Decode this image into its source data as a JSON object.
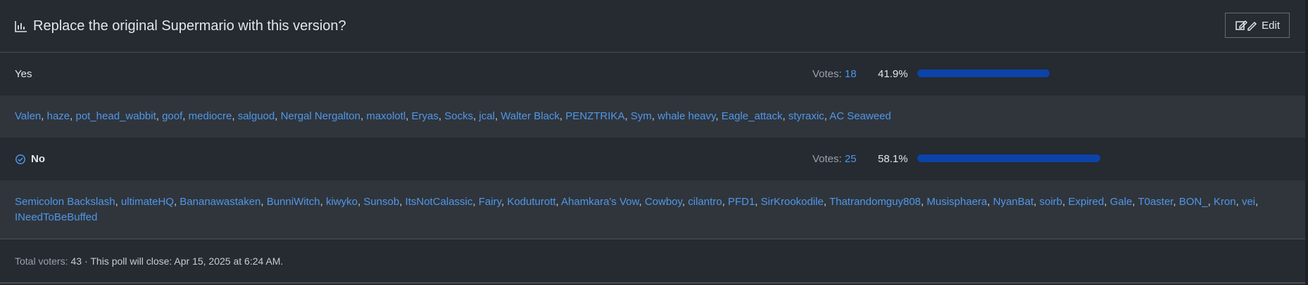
{
  "poll": {
    "title": "Replace the original Supermario with this version?",
    "edit_label": "Edit",
    "votes_label": "Votes: ",
    "total_voters_label": "Total voters:",
    "total_voters": "43",
    "closing_text": "· This poll will close: Apr 15, 2025 at 6:24 AM.",
    "options": [
      {
        "label": "Yes",
        "votes": "18",
        "percent": "41.9%",
        "fraction": 0.419,
        "selected": false,
        "voters": [
          "Valen",
          "haze",
          "pot_head_wabbit",
          "goof",
          "mediocre",
          "salguod",
          "Nergal Nergalton",
          "maxolotl",
          "Eryas",
          "Socks",
          "jcal",
          "Walter Black",
          "PENZTRIKA",
          "Sym",
          "whale heavy",
          "Eagle_attack",
          "styraxic",
          "AC Seaweed"
        ]
      },
      {
        "label": "No",
        "votes": "25",
        "percent": "58.1%",
        "fraction": 0.581,
        "selected": true,
        "voters": [
          "Semicolon Backslash",
          "ultimateHQ",
          "Bananawastaken",
          "BunniWitch",
          "kiwyko",
          "Sunsob",
          "ItsNotCalassic",
          "Fairy",
          "Koduturott",
          "Ahamkara's Vow",
          "Cowboy",
          "cilantro",
          "PFD1",
          "SirKrookodile",
          "Thatrandomguy808",
          "Musisphaera",
          "NyanBat",
          "soirb",
          "Expired",
          "Gale",
          "T0aster",
          "BON_",
          "Kron",
          "vei",
          "INeedToBeBuffed"
        ]
      }
    ]
  },
  "icons": {
    "title_icon": "bar-chart-icon",
    "edit_icon": "edit-icon",
    "selected_icon": "check-circle-icon"
  },
  "colors": {
    "bar": "#0b43a8",
    "link": "#4f97e8"
  }
}
